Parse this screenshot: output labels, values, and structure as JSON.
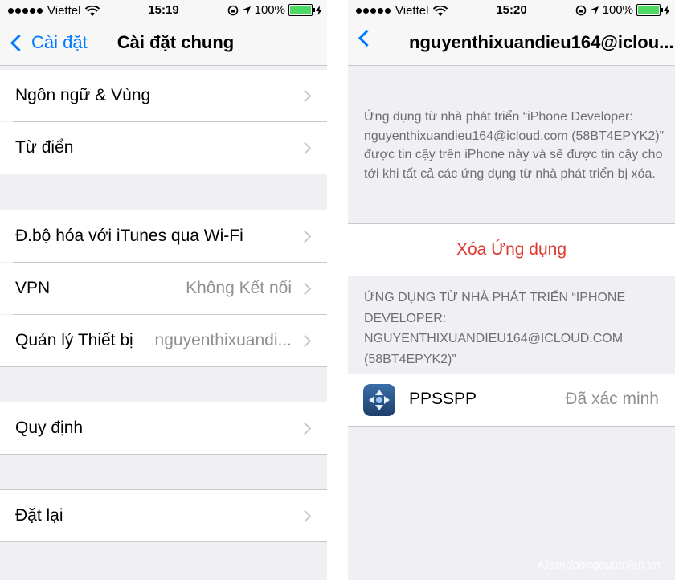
{
  "left": {
    "status": {
      "carrier": "Viettel",
      "time": "15:19",
      "battery": "100%"
    },
    "nav": {
      "back_label": "Cài đặt",
      "title": "Cài đặt chung"
    },
    "rows": [
      {
        "label": "Ngôn ngữ & Vùng"
      },
      {
        "label": "Từ điển"
      },
      {
        "label": "Đ.bộ hóa với iTunes qua Wi-Fi"
      },
      {
        "label": "VPN",
        "value": "Không Kết nối"
      },
      {
        "label": "Quản lý Thiết bị",
        "value": "nguyenthixuandi..."
      },
      {
        "label": "Quy định"
      },
      {
        "label": "Đặt lại"
      }
    ]
  },
  "right": {
    "status": {
      "carrier": "Viettel",
      "time": "15:20",
      "battery": "100%"
    },
    "nav": {
      "title": "nguyenthixuandieu164@iclou..."
    },
    "description": "Ứng dụng từ nhà phát triển “iPhone Developer: nguyenthixuandieu164@icloud.com (58BT4EPYK2)” được tin cậy trên iPhone này và sẽ được tin cậy cho tới khi tất cả các ứng dụng từ nhà phát triển bị xóa.",
    "delete_label": "Xóa Ứng dụng",
    "section_header": "ỨNG DỤNG TỪ NHÀ PHÁT TRIỂN “IPHONE DEVELOPER: NGUYENTHIXUANDIEU164@ICLOUD.COM (58BT4EPYK2)”",
    "app": {
      "name": "PPSSPP",
      "status": "Đã xác minh",
      "icon": "ppsspp-app-icon"
    }
  },
  "watermark": "Kiemdoongcuuthien.vn",
  "colors": {
    "accent": "#007aff",
    "destructive": "#e0382f",
    "secondary_text": "#8e8e93",
    "background": "#efeff4",
    "battery": "#4cd964"
  }
}
